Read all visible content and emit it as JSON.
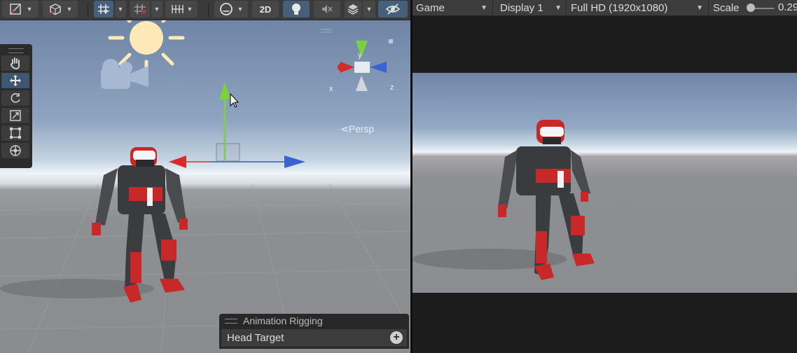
{
  "scene_toolbar": {
    "two_d_label": "2D",
    "icons": [
      "draw-mode-icon",
      "shading-mode-icon",
      "grid-snap-icon",
      "increment-snap-icon",
      "snap-settings-icon",
      "render-mode-icon",
      "lighting-toggle-icon",
      "audio-mute-icon",
      "effects-icon",
      "hidden-objects-icon"
    ]
  },
  "scene_view": {
    "persp_label": "Persp",
    "axes": {
      "x": "x",
      "y": "y",
      "z": "z"
    },
    "tools": [
      "hand-tool",
      "move-tool",
      "rotate-tool",
      "scale-tool",
      "rect-tool",
      "transform-tool"
    ],
    "active_tool": "move-tool"
  },
  "overlay": {
    "title": "Animation Rigging",
    "item": "Head Target"
  },
  "game_toolbar": {
    "tab": "Game",
    "display": "Display 1",
    "resolution": "Full HD (1920x1080)",
    "scale_label": "Scale",
    "scale_value": "0.29"
  },
  "colors": {
    "x_axis": "#d62b2b",
    "y_axis": "#7bd13c",
    "z_axis": "#3a62d1",
    "active_toolbar": "#46607c"
  }
}
